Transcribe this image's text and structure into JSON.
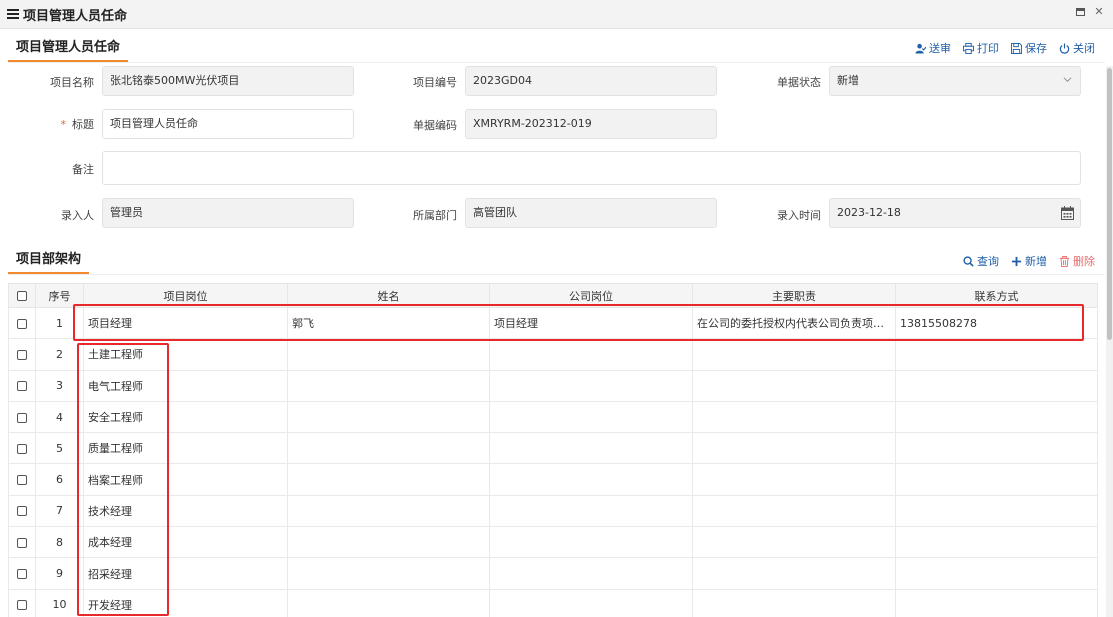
{
  "window": {
    "title": "项目管理人员任命"
  },
  "form_section": {
    "title": "项目管理人员任命",
    "toolbar": {
      "submit": "送审",
      "print": "打印",
      "save": "保存",
      "close": "关闭"
    },
    "fields": {
      "project_name": {
        "label": "项目名称",
        "value": "张北铭泰500MW光伏项目"
      },
      "project_code": {
        "label": "项目编号",
        "value": "2023GD04"
      },
      "doc_status": {
        "label": "单据状态",
        "value": "新增"
      },
      "title": {
        "label": "标题",
        "value": "项目管理人员任命",
        "required_mark": "*"
      },
      "doc_code": {
        "label": "单据编码",
        "value": "XMRYRM-202312-019"
      },
      "remark": {
        "label": "备注",
        "value": ""
      },
      "entered_by": {
        "label": "录入人",
        "value": "管理员"
      },
      "department": {
        "label": "所属部门",
        "value": "高管团队"
      },
      "entered_at": {
        "label": "录入时间",
        "value": "2023-12-18"
      }
    }
  },
  "org_section": {
    "title": "项目部架构",
    "toolbar": {
      "query": "查询",
      "add": "新增",
      "delete": "删除"
    },
    "columns": [
      "序号",
      "项目岗位",
      "姓名",
      "公司岗位",
      "主要职责",
      "联系方式"
    ],
    "rows": [
      {
        "no": "1",
        "post": "项目经理",
        "name": "郭飞",
        "company_post": "项目经理",
        "duty": "在公司的委托授权内代表公司负责项目的...",
        "contact": "13815508278"
      },
      {
        "no": "2",
        "post": "土建工程师",
        "name": "",
        "company_post": "",
        "duty": "",
        "contact": ""
      },
      {
        "no": "3",
        "post": "电气工程师",
        "name": "",
        "company_post": "",
        "duty": "",
        "contact": ""
      },
      {
        "no": "4",
        "post": "安全工程师",
        "name": "",
        "company_post": "",
        "duty": "",
        "contact": ""
      },
      {
        "no": "5",
        "post": "质量工程师",
        "name": "",
        "company_post": "",
        "duty": "",
        "contact": ""
      },
      {
        "no": "6",
        "post": "档案工程师",
        "name": "",
        "company_post": "",
        "duty": "",
        "contact": ""
      },
      {
        "no": "7",
        "post": "技术经理",
        "name": "",
        "company_post": "",
        "duty": "",
        "contact": ""
      },
      {
        "no": "8",
        "post": "成本经理",
        "name": "",
        "company_post": "",
        "duty": "",
        "contact": ""
      },
      {
        "no": "9",
        "post": "招采经理",
        "name": "",
        "company_post": "",
        "duty": "",
        "contact": ""
      },
      {
        "no": "10",
        "post": "开发经理",
        "name": "",
        "company_post": "",
        "duty": "",
        "contact": ""
      }
    ]
  },
  "colors": {
    "accent": "#f08a2c",
    "link": "#1f5fa8",
    "danger": "#e86b6b",
    "highlight": "#e8282a"
  }
}
